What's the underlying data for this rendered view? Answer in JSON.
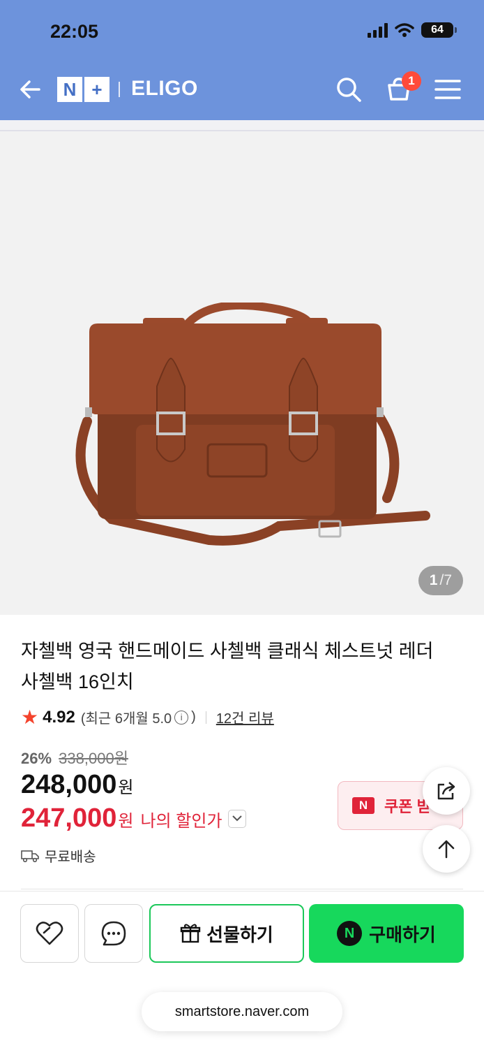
{
  "status_bar": {
    "time": "22:05",
    "battery": "64"
  },
  "header": {
    "logo_n": "N",
    "logo_plus": "+",
    "brand": "ELIGO",
    "cart_count": "1",
    "colors": {
      "header_bg": "#6d93dc",
      "badge": "#ff4a3a"
    }
  },
  "gallery": {
    "current": "1",
    "total": "/7"
  },
  "product": {
    "title": "자첼백 영국 핸드메이드 사첼백 클래식 체스트넛 레더 사첼백 16인치",
    "rating_star": "★",
    "rating_score": "4.92",
    "recent_prefix": "(최근 6개월 5.0",
    "info_glyph": "i",
    "recent_suffix": ")",
    "review_link": "12건 리뷰",
    "discount_pct": "26%",
    "original_price": "338,000원",
    "price": "248,000",
    "price_unit": "원",
    "my_price": "247,000",
    "my_price_unit": "원",
    "my_price_label": "나의 할인가",
    "shipping": "무료배송",
    "coupon_badge": "N",
    "coupon_label": "쿠폰 받"
  },
  "actions": {
    "gift_label": "선물하기",
    "buy_badge": "N",
    "buy_label": "구매하기",
    "colors": {
      "buy_bg": "#17d85c",
      "gift_border": "#1cc85a",
      "sale_red": "#e02339"
    }
  },
  "browser": {
    "url": "smartstore.naver.com"
  }
}
